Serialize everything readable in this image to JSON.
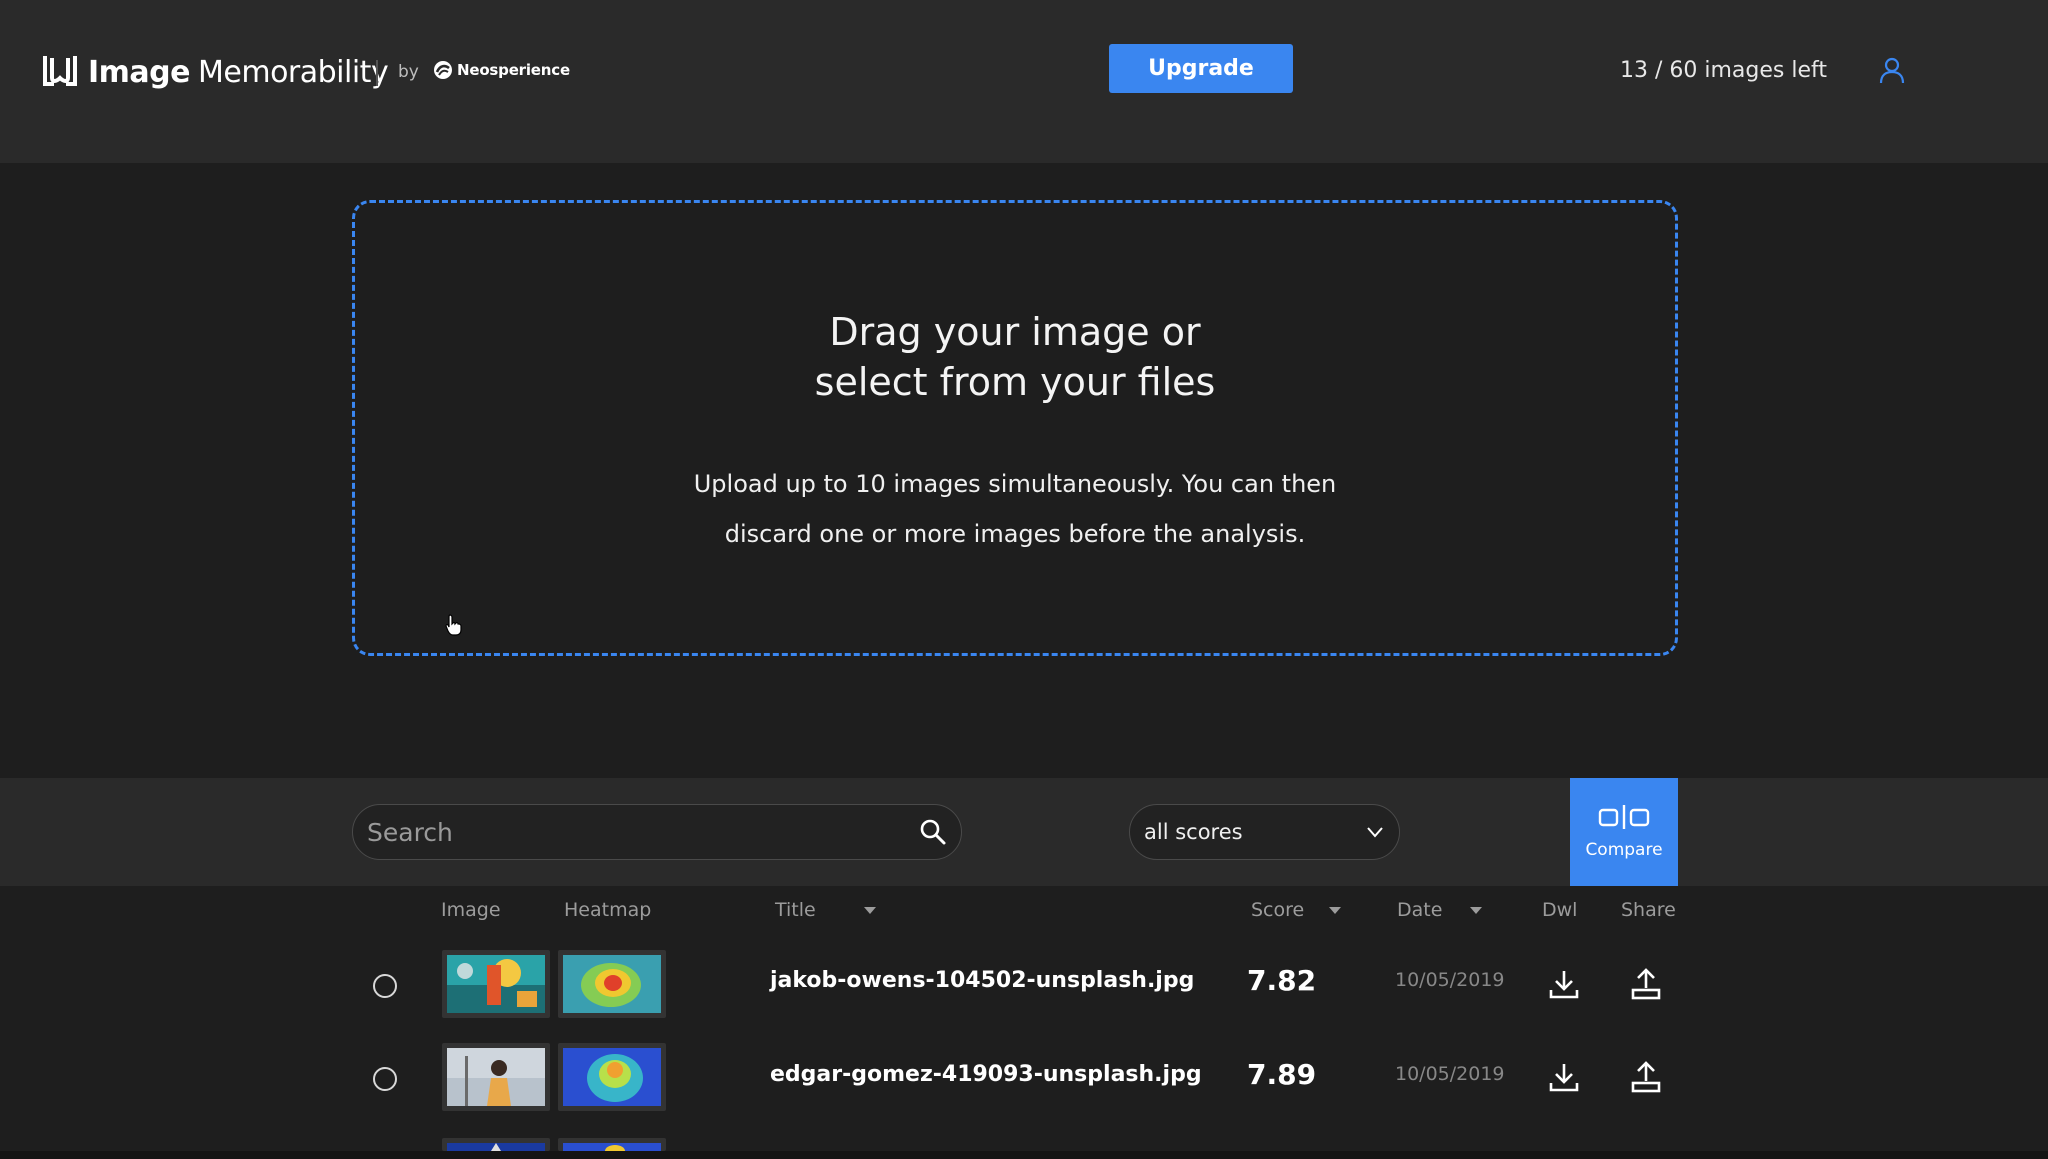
{
  "header": {
    "app_name_bold": "Image",
    "app_name_light": "Memorability",
    "by_label": "by",
    "partner_name": "Neosperience",
    "upgrade_label": "Upgrade",
    "quota_text": "13 / 60 images left",
    "user_icon": "user-icon",
    "accent_color": "#3a86f0"
  },
  "dropzone": {
    "title": "Drag your image or\nselect from your files",
    "subtitle": "Upload up to 10 images simultaneously. You can then\ndiscard one or more images before the analysis."
  },
  "toolbar": {
    "search_placeholder": "Search",
    "search_value": "",
    "score_filter_value": "all scores",
    "compare_label": "Compare"
  },
  "table": {
    "columns": {
      "image": "Image",
      "heatmap": "Heatmap",
      "title": "Title",
      "score": "Score",
      "date": "Date",
      "download": "Dwl",
      "share": "Share"
    },
    "rows": [
      {
        "title": "jakob-owens-104502-unsplash.jpg",
        "score": "7.82",
        "date": "10/05/2019",
        "selected": false
      },
      {
        "title": "edgar-gomez-419093-unsplash.jpg",
        "score": "7.89",
        "date": "10/05/2019",
        "selected": false
      }
    ]
  }
}
